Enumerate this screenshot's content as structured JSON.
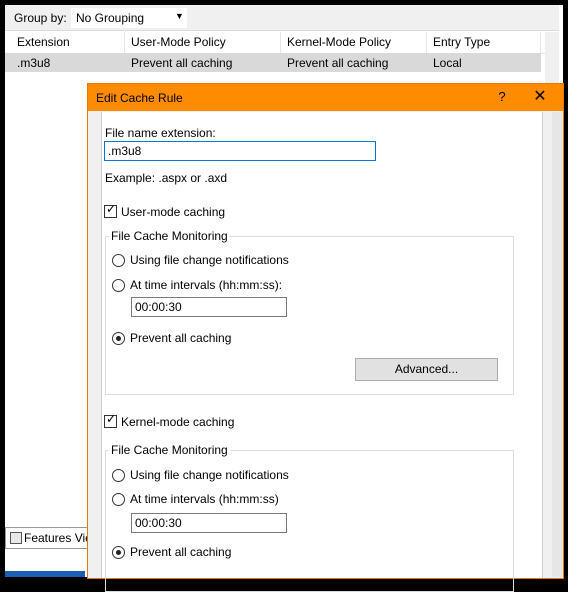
{
  "background_window": {
    "group_by_label": "Group by:",
    "group_by_value": "No Grouping",
    "columns": [
      "Extension",
      "User-Mode Policy",
      "Kernel-Mode Policy",
      "Entry Type"
    ],
    "rows": [
      {
        "extension": ".m3u8",
        "user_mode_policy": "Prevent all caching",
        "kernel_mode_policy": "Prevent all caching",
        "entry_type": "Local"
      }
    ],
    "features_view_tab": "Features View"
  },
  "dialog": {
    "title": "Edit Cache Rule",
    "help_button": "?",
    "close_button": "✕",
    "file_extension_label": "File name extension:",
    "file_extension_value": ".m3u8",
    "example_text": "Example: .aspx or .axd",
    "user_mode": {
      "checkbox_label": "User-mode caching",
      "checked": true,
      "group_title": "File Cache Monitoring",
      "option_notifications": "Using file change notifications",
      "option_intervals": "At time intervals (hh:mm:ss):",
      "interval_value": "00:00:30",
      "option_prevent": "Prevent all caching",
      "selected_option": "prevent",
      "advanced_button": "Advanced..."
    },
    "kernel_mode": {
      "checkbox_label": "Kernel-mode caching",
      "checked": true,
      "group_title": "File Cache Monitoring",
      "option_notifications": "Using file change notifications",
      "option_intervals": "At time intervals (hh:mm:ss)",
      "interval_value": "00:00:30",
      "option_prevent": "Prevent all caching",
      "selected_option": "prevent"
    }
  },
  "colors": {
    "title_bar": "#ff8c00",
    "selected_row": "#d9d9d9",
    "focus_border": "#0078d7"
  }
}
